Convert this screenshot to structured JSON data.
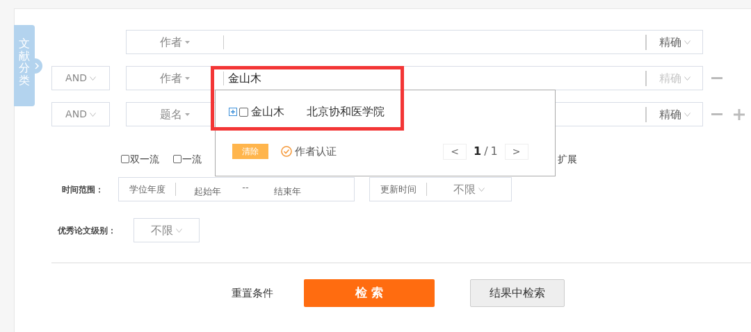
{
  "sidebar_tab": {
    "label": "文献分类"
  },
  "search_rows": [
    {
      "field": "作者",
      "value": "",
      "match": "精确",
      "match_disabled": false,
      "removable": false,
      "addable": false
    },
    {
      "operator": "AND",
      "field": "作者",
      "value": "金山木",
      "match": "精确",
      "match_disabled": true,
      "removable": true,
      "addable": false
    },
    {
      "operator": "AND",
      "field": "题名",
      "value": "",
      "match": "精确",
      "match_disabled": false,
      "removable": true,
      "addable": true
    }
  ],
  "suggestions": {
    "highlighted": true,
    "items": [
      {
        "name": "金山木",
        "affiliation": "北京协和医学院",
        "checked": false
      }
    ],
    "clear_button": "清除",
    "verify_label": "作者认证",
    "prev": "<",
    "page_current": "1",
    "page_sep": "/",
    "page_total": "1",
    "next": ">"
  },
  "filters": {
    "options": [
      {
        "label": "双一流",
        "checked": false
      },
      {
        "label": "一流",
        "checked": false
      }
    ],
    "trailing_text": "扩展"
  },
  "time_range": {
    "label": "时间范围：",
    "type": "学位年度",
    "start_placeholder": "起始年",
    "separator": "--",
    "end_placeholder": "结束年",
    "update_label": "更新时间",
    "update_value": "不限"
  },
  "excellence": {
    "label": "优秀论文级别：",
    "value": "不限"
  },
  "actions": {
    "reset": "重置条件",
    "search": "检 索",
    "search_within": "结果中检索"
  }
}
